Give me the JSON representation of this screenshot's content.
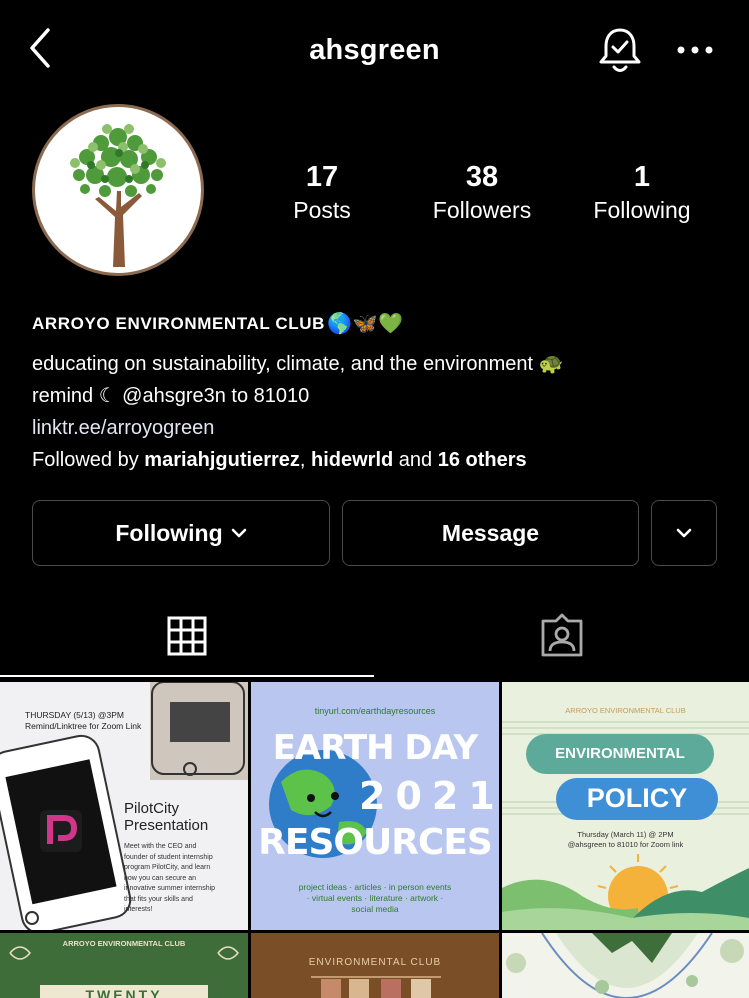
{
  "header": {
    "username": "ahsgreen"
  },
  "stats": [
    {
      "count": "17",
      "label": "Posts"
    },
    {
      "count": "38",
      "label": "Followers"
    },
    {
      "count": "1",
      "label": "Following"
    }
  ],
  "bio": {
    "name": "ARROYO ENVIRONMENTAL CLUB",
    "name_emojis": "🌎🦋💚",
    "line1": "educating on sustainability, climate, and the environment 🐢",
    "line2": "remind ☾ @ahsgre3n to 81010",
    "link": "linktr.ee/arroyogreen",
    "followed_prefix": "Followed by ",
    "followed_user1": "mariahjgutierrez",
    "followed_sep": ", ",
    "followed_user2": "hidewrld",
    "followed_and": " and ",
    "followed_others": "16 others"
  },
  "buttons": {
    "following": "Following",
    "message": "Message"
  },
  "posts": [
    {
      "date": "THURSDAY (5/13) @3PM",
      "sub": "Remind/Linktree for Zoom Link",
      "title1": "PilotCity",
      "title2": "Presentation",
      "body": [
        "Meet with the CEO and",
        "founder of student internship",
        "program PilotCity, and learn",
        "how you can secure an",
        "innovative summer internship",
        "that fits your skills and",
        "interests!"
      ]
    },
    {
      "url": "tinyurl.com/earthdayresources",
      "line1": "EARTH DAY",
      "year": "2021",
      "line3": "RESOURCES",
      "footer1": "project ideas · articles · in person events",
      "footer2": "· virtual events · literature · artwork ·",
      "footer3": "social media"
    },
    {
      "club": "ARROYO ENVIRONMENTAL CLUB",
      "word1": "ENVIRONMENTAL",
      "word2": "POLICY",
      "when": "Thursday (March 11) @ 2PM",
      "where": "@ahsgreen to 81010 for Zoom link"
    },
    {
      "club": "ARROYO ENVIRONMENTAL CLUB",
      "word": "TWENTY"
    },
    {
      "club": "ENVIRONMENTAL CLUB"
    },
    {}
  ],
  "colors": {
    "background": "#000000",
    "border": "#4a4a4a",
    "tree_green": "#4f9a3a",
    "trunk": "#8a5a3a"
  },
  "icons": [
    "back-arrow-icon",
    "bell-check-icon",
    "more-dots-icon",
    "chevron-down-icon",
    "grid-icon",
    "tagged-person-icon"
  ]
}
